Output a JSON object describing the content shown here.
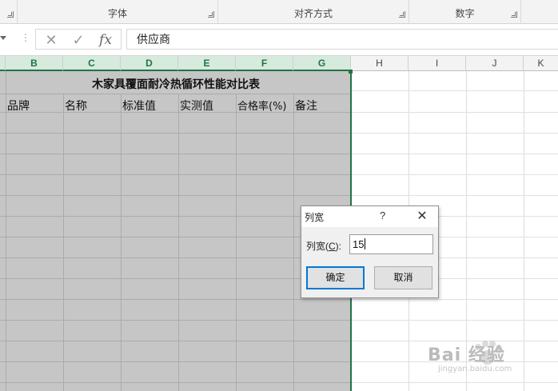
{
  "ribbon": {
    "groups": [
      {
        "label": "字体"
      },
      {
        "label": "对齐方式"
      },
      {
        "label": "数字"
      }
    ]
  },
  "formula_bar": {
    "separator": "⋮",
    "cancel_glyph": "✕",
    "enter_glyph": "✓",
    "fx_glyph": "fx",
    "value": "供应商"
  },
  "columns": [
    "B",
    "C",
    "D",
    "E",
    "F",
    "G",
    "H",
    "I",
    "J",
    "K"
  ],
  "sheet": {
    "title": "木家具覆面耐冷热循环性能对比表",
    "headers": [
      "品牌",
      "名称",
      "标准值",
      "实测值",
      "合格率(%)",
      "备注"
    ]
  },
  "dialog": {
    "title": "列宽",
    "help": "?",
    "close": "✕",
    "field_label": "列宽(",
    "field_accel": "C",
    "field_label_end": "):",
    "field_value": "15",
    "ok_label": "确定",
    "cancel_label": "取消"
  },
  "watermark": {
    "brand": "Bai  经验",
    "url": "jingyan.baidu.com"
  },
  "colors": {
    "selection_green": "#217346",
    "selected_range": "#c6c6c6",
    "dialog_focus": "#0078d7"
  }
}
